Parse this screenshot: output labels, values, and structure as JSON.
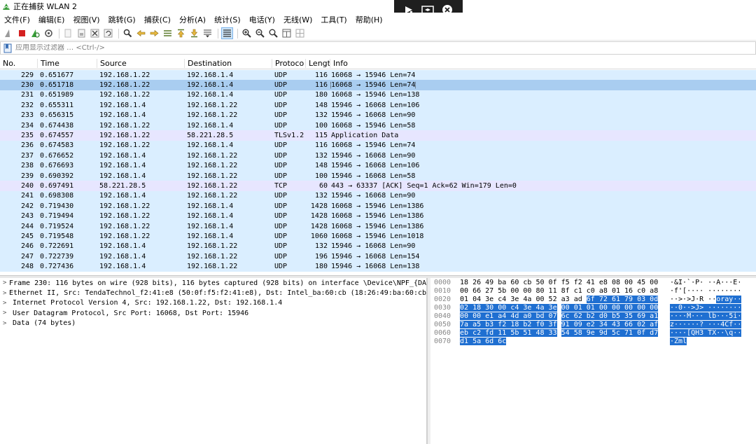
{
  "window": {
    "title": "正在捕获 WLAN 2"
  },
  "overlay": {
    "icons": [
      "play-arrow-icon",
      "swap-screen-icon",
      "close-icon"
    ]
  },
  "menu": [
    "文件(F)",
    "编辑(E)",
    "视图(V)",
    "跳转(G)",
    "捕获(C)",
    "分析(A)",
    "统计(S)",
    "电话(Y)",
    "无线(W)",
    "工具(T)",
    "帮助(H)"
  ],
  "filter": {
    "placeholder": "应用显示过滤器 … <Ctrl-/>"
  },
  "columns": {
    "no": "No.",
    "time": "Time",
    "source": "Source",
    "destination": "Destination",
    "protocol": "Protoco",
    "length": "Lengt",
    "info": "Info"
  },
  "packets": [
    {
      "no": "229",
      "time": "0.651677",
      "src": "192.168.1.22",
      "dst": "192.168.1.4",
      "proto": "UDP",
      "len": "116",
      "info": "16068 → 15946 Len=74",
      "kind": "udp"
    },
    {
      "no": "230",
      "time": "0.651718",
      "src": "192.168.1.22",
      "dst": "192.168.1.4",
      "proto": "UDP",
      "len": "116",
      "info": "16068 → 15946 Len=74",
      "kind": "sel"
    },
    {
      "no": "231",
      "time": "0.651989",
      "src": "192.168.1.22",
      "dst": "192.168.1.4",
      "proto": "UDP",
      "len": "180",
      "info": "16068 → 15946 Len=138",
      "kind": "udp"
    },
    {
      "no": "232",
      "time": "0.655311",
      "src": "192.168.1.4",
      "dst": "192.168.1.22",
      "proto": "UDP",
      "len": "148",
      "info": "15946 → 16068 Len=106",
      "kind": "udp"
    },
    {
      "no": "233",
      "time": "0.656315",
      "src": "192.168.1.4",
      "dst": "192.168.1.22",
      "proto": "UDP",
      "len": "132",
      "info": "15946 → 16068 Len=90",
      "kind": "udp"
    },
    {
      "no": "234",
      "time": "0.674438",
      "src": "192.168.1.22",
      "dst": "192.168.1.4",
      "proto": "UDP",
      "len": "100",
      "info": "16068 → 15946 Len=58",
      "kind": "udp"
    },
    {
      "no": "235",
      "time": "0.674557",
      "src": "192.168.1.22",
      "dst": "58.221.28.5",
      "proto": "TLSv1.2",
      "len": "115",
      "info": "Application Data",
      "kind": "tcp"
    },
    {
      "no": "236",
      "time": "0.674583",
      "src": "192.168.1.22",
      "dst": "192.168.1.4",
      "proto": "UDP",
      "len": "116",
      "info": "16068 → 15946 Len=74",
      "kind": "udp"
    },
    {
      "no": "237",
      "time": "0.676652",
      "src": "192.168.1.4",
      "dst": "192.168.1.22",
      "proto": "UDP",
      "len": "132",
      "info": "15946 → 16068 Len=90",
      "kind": "udp"
    },
    {
      "no": "238",
      "time": "0.676693",
      "src": "192.168.1.4",
      "dst": "192.168.1.22",
      "proto": "UDP",
      "len": "148",
      "info": "15946 → 16068 Len=106",
      "kind": "udp"
    },
    {
      "no": "239",
      "time": "0.690392",
      "src": "192.168.1.4",
      "dst": "192.168.1.22",
      "proto": "UDP",
      "len": "100",
      "info": "15946 → 16068 Len=58",
      "kind": "udp"
    },
    {
      "no": "240",
      "time": "0.697491",
      "src": "58.221.28.5",
      "dst": "192.168.1.22",
      "proto": "TCP",
      "len": "60",
      "info": "443 → 63337 [ACK] Seq=1 Ack=62 Win=179 Len=0",
      "kind": "tcp"
    },
    {
      "no": "241",
      "time": "0.698308",
      "src": "192.168.1.4",
      "dst": "192.168.1.22",
      "proto": "UDP",
      "len": "132",
      "info": "15946 → 16068 Len=90",
      "kind": "udp"
    },
    {
      "no": "242",
      "time": "0.719430",
      "src": "192.168.1.22",
      "dst": "192.168.1.4",
      "proto": "UDP",
      "len": "1428",
      "info": "16068 → 15946 Len=1386",
      "kind": "udp"
    },
    {
      "no": "243",
      "time": "0.719494",
      "src": "192.168.1.22",
      "dst": "192.168.1.4",
      "proto": "UDP",
      "len": "1428",
      "info": "16068 → 15946 Len=1386",
      "kind": "udp"
    },
    {
      "no": "244",
      "time": "0.719524",
      "src": "192.168.1.22",
      "dst": "192.168.1.4",
      "proto": "UDP",
      "len": "1428",
      "info": "16068 → 15946 Len=1386",
      "kind": "udp"
    },
    {
      "no": "245",
      "time": "0.719548",
      "src": "192.168.1.22",
      "dst": "192.168.1.4",
      "proto": "UDP",
      "len": "1060",
      "info": "16068 → 15946 Len=1018",
      "kind": "udp"
    },
    {
      "no": "246",
      "time": "0.722691",
      "src": "192.168.1.4",
      "dst": "192.168.1.22",
      "proto": "UDP",
      "len": "132",
      "info": "15946 → 16068 Len=90",
      "kind": "udp"
    },
    {
      "no": "247",
      "time": "0.722739",
      "src": "192.168.1.4",
      "dst": "192.168.1.22",
      "proto": "UDP",
      "len": "196",
      "info": "15946 → 16068 Len=154",
      "kind": "udp"
    },
    {
      "no": "248",
      "time": "0.727436",
      "src": "192.168.1.4",
      "dst": "192.168.1.22",
      "proto": "UDP",
      "len": "180",
      "info": "15946 → 16068 Len=138",
      "kind": "udp"
    }
  ],
  "details": [
    "Frame 230: 116 bytes on wire (928 bits), 116 bytes captured (928 bits) on interface \\Device\\NPF_{DA",
    "Ethernet II, Src: TendaTechnol_f2:41:e8 (50:0f:f5:f2:41:e8), Dst: Intel_ba:60:cb (18:26:49:ba:60:cb",
    "Internet Protocol Version 4, Src: 192.168.1.22, Dst: 192.168.1.4",
    "User Datagram Protocol, Src Port: 16068, Dst Port: 15946",
    "Data (74 bytes)"
  ],
  "bytes": [
    {
      "off": "0000",
      "hex": "18 26 49 ba 60 cb 50 0f  f5 f2 41 e8 08 00 45 00",
      "hl_from": -1,
      "asc": "·&I·`·P· ··A···E·",
      "asc_hl_from": -1
    },
    {
      "off": "0010",
      "hex": "00 66 27 5b 00 00 80 11  8f c1 c0 a8 01 16 c0 a8",
      "hl_from": -1,
      "asc": "·f'[···· ········",
      "asc_hl_from": -1
    },
    {
      "off": "0020",
      "hex": "01 04 3e c4 3e 4a 00 52  a3 ad 6f 72 61 79 03 0d",
      "hl_from": 10,
      "asc": "··>·>J·R ··oray··",
      "asc_hl_from": 11
    },
    {
      "off": "0030",
      "hex": "02 18 30 00 c4 3e 4a 3e  00 01 01 00 00 00 00 00",
      "hl_from": 0,
      "asc": "··0··>J> ········",
      "asc_hl_from": 0
    },
    {
      "off": "0040",
      "hex": "00 00 e1 a4 4d a0 bd 07  6c 62 b2 d0 b5 35 69 a1",
      "hl_from": 0,
      "asc": "····M··· lb···5i·",
      "asc_hl_from": 0
    },
    {
      "off": "0050",
      "hex": "7a a5 b3 f2 18 b2 f0 3f  91 09 e2 34 43 66 02 af",
      "hl_from": 0,
      "asc": "z······? ···4Cf··",
      "asc_hl_from": 0
    },
    {
      "off": "0060",
      "hex": "eb c2 fd 11 5b 51 48 33  54 58 9e 9d 5c 71 0f d7",
      "hl_from": 0,
      "asc": "····[QH3 TX··\\q··",
      "asc_hl_from": 0
    },
    {
      "off": "0070",
      "hex": "d1 5a 6d 6c",
      "hl_from": 0,
      "asc": "·Zml",
      "asc_hl_from": 0
    }
  ],
  "toolbar_icons": [
    "shark-fin-start-icon",
    "stop-square-icon",
    "restart-capture-icon",
    "capture-options-gear-icon",
    "open-file-icon",
    "save-file-icon",
    "close-file-icon",
    "reload-icon",
    "find-packet-icon",
    "back-arrow-icon",
    "forward-arrow-icon",
    "go-to-packet-icon",
    "first-packet-icon",
    "last-packet-icon",
    "autoscroll-icon",
    "colorize-icon",
    "zoom-in-icon",
    "zoom-out-icon",
    "zoom-normal-icon",
    "resize-columns-icon",
    "layout-icon"
  ]
}
